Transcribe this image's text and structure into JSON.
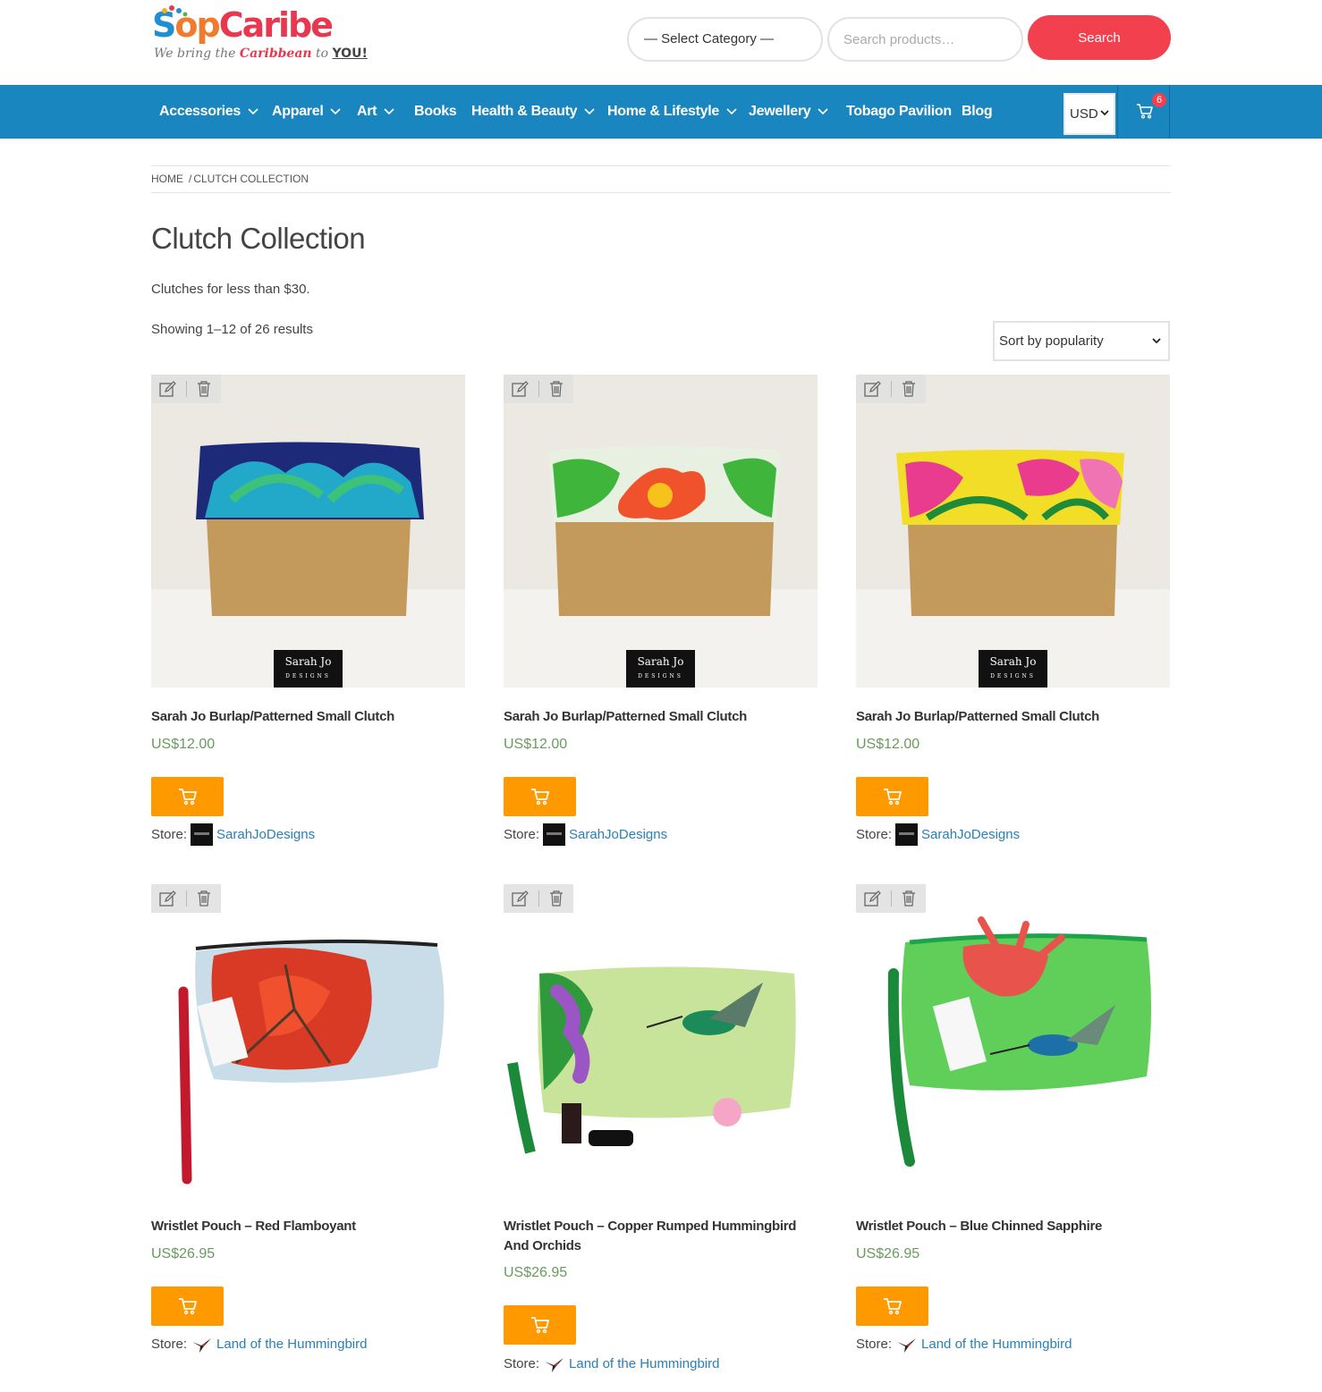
{
  "header": {
    "logo_text_1": "S",
    "logo_text_2": "op",
    "logo_text_3": "Caribe",
    "tagline_1": "We bring the ",
    "tagline_2": "Caribbean",
    "tagline_3": " to ",
    "tagline_4": "YOU!",
    "category_select": "— Select Category —",
    "search_placeholder": "Search products…",
    "search_button": "Search"
  },
  "nav": {
    "items": [
      {
        "label": "Accessories",
        "dropdown": true
      },
      {
        "label": "Apparel",
        "dropdown": true
      },
      {
        "label": "Art",
        "dropdown": true
      },
      {
        "label": "Books",
        "dropdown": false
      },
      {
        "label": "Health & Beauty",
        "dropdown": true
      },
      {
        "label": "Home & Lifestyle",
        "dropdown": true
      },
      {
        "label": "Jewellery",
        "dropdown": true
      },
      {
        "label": "Tobago Pavilion",
        "dropdown": false
      },
      {
        "label": "Blog",
        "dropdown": false
      }
    ],
    "currency": "USD",
    "cart_count": "6"
  },
  "breadcrumb": {
    "home": "Home",
    "separator": "/",
    "current": "Clutch Collection"
  },
  "page": {
    "title": "Clutch Collection",
    "description": "Clutches for less than $30.",
    "result_count": "Showing 1–12 of 26 results",
    "sort_label": "Sort by popularity"
  },
  "products": [
    {
      "title": "Sarah Jo Burlap/Patterned Small Clutch",
      "price": "US$12.00",
      "store_label": "Store:",
      "store": "SarahJoDesigns",
      "brand_text": "Sarah Jo",
      "brand_sub": "DESIGNS"
    },
    {
      "title": "Sarah Jo Burlap/Patterned Small Clutch",
      "price": "US$12.00",
      "store_label": "Store:",
      "store": "SarahJoDesigns",
      "brand_text": "Sarah Jo",
      "brand_sub": "DESIGNS"
    },
    {
      "title": "Sarah Jo Burlap/Patterned Small Clutch",
      "price": "US$12.00",
      "store_label": "Store:",
      "store": "SarahJoDesigns",
      "brand_text": "Sarah Jo",
      "brand_sub": "DESIGNS"
    },
    {
      "title": "Wristlet Pouch – Red Flamboyant",
      "price": "US$26.95",
      "store_label": "Store:",
      "store": "Land of the Hummingbird"
    },
    {
      "title": "Wristlet Pouch – Copper Rumped Hummingbird And Orchids",
      "price": "US$26.95",
      "store_label": "Store:",
      "store": "Land of the Hummingbird"
    },
    {
      "title": "Wristlet Pouch – Blue Chinned Sapphire",
      "price": "US$26.95",
      "store_label": "Store:",
      "store": "Land of the Hummingbird"
    }
  ],
  "colors": {
    "nav_bg": "#1a86c0",
    "search_button": "#f3404f",
    "cart_button": "#ff9900",
    "price": "#6a9a5e",
    "store_link": "#2a7fb4"
  }
}
